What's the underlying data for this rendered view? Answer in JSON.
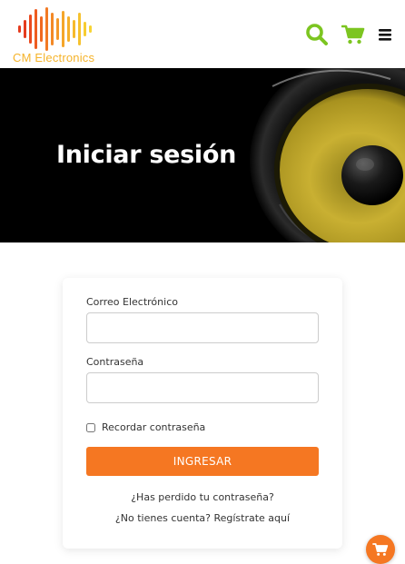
{
  "brand": {
    "name": "CM Electronics",
    "colors": {
      "accent_green": "#7cc520",
      "accent_orange": "#f57722",
      "logo_yellow": "#f5b32a",
      "logo_red": "#e53b1e"
    }
  },
  "header": {
    "icons": [
      "search-icon",
      "cart-icon",
      "menu-icon"
    ]
  },
  "hero": {
    "title": "Iniciar sesión"
  },
  "login_form": {
    "email_label": "Correo Electrónico",
    "email_value": "",
    "password_label": "Contraseña",
    "password_value": "",
    "remember_label": "Recordar contraseña",
    "remember_checked": false,
    "submit_label": "INGRESAR",
    "forgot_link": "¿Has perdido tu contraseña?",
    "register_link": "¿No tienes cuenta? Regístrate aquí"
  },
  "floating_cart": {
    "icon": "cart-icon"
  }
}
